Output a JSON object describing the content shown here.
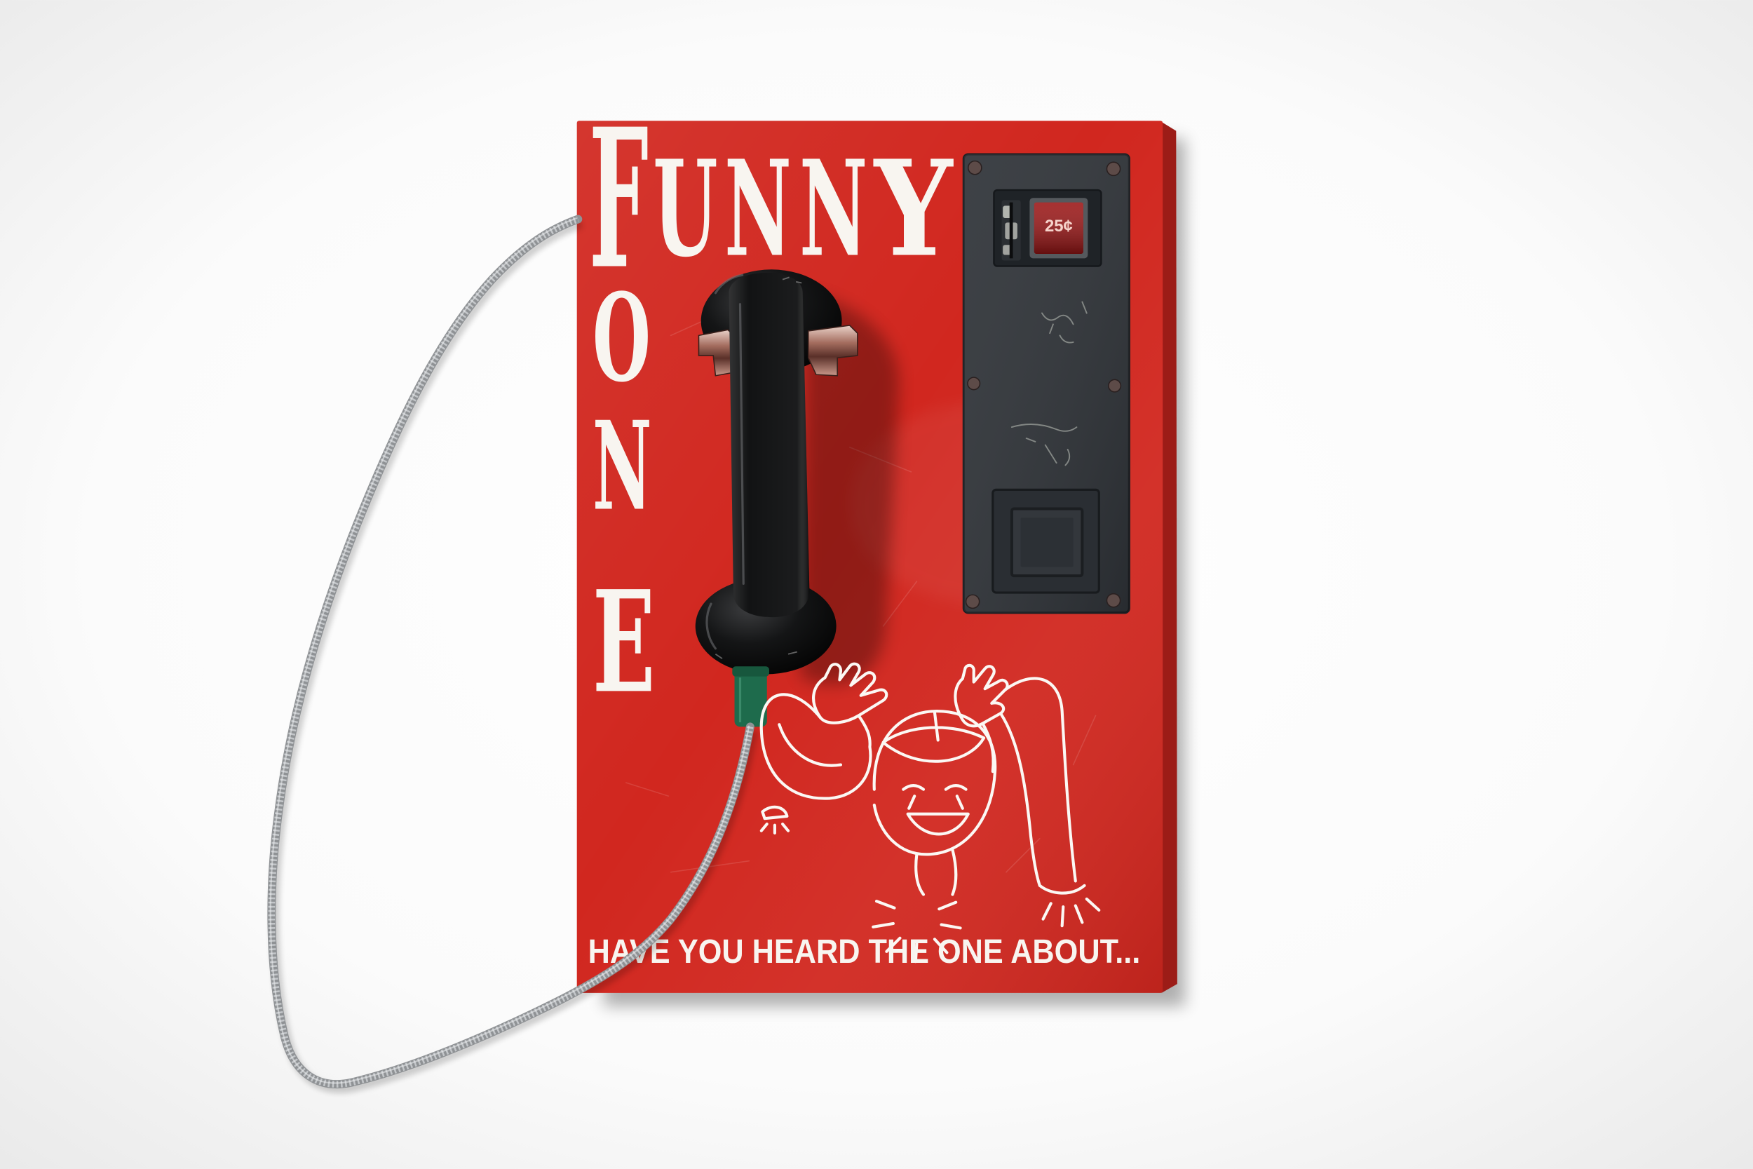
{
  "scene": {
    "sign": {
      "word_across": "FUNNY",
      "word_down": "FONE",
      "tagline": "HAVE YOU HEARD THE ONE ABOUT..."
    },
    "coin_mechanism": {
      "price_label": "25¢"
    }
  },
  "colors": {
    "background": "#ffffff",
    "panel_red": "#d1271f",
    "panel_edge": "#9c1c17",
    "lettering": "#f8f5f0",
    "coin_plate": "#2f3338",
    "price_window": "#9a1515",
    "handset": "#121314",
    "cord": "#8f9295",
    "boot_green": "#1e6b4c"
  }
}
